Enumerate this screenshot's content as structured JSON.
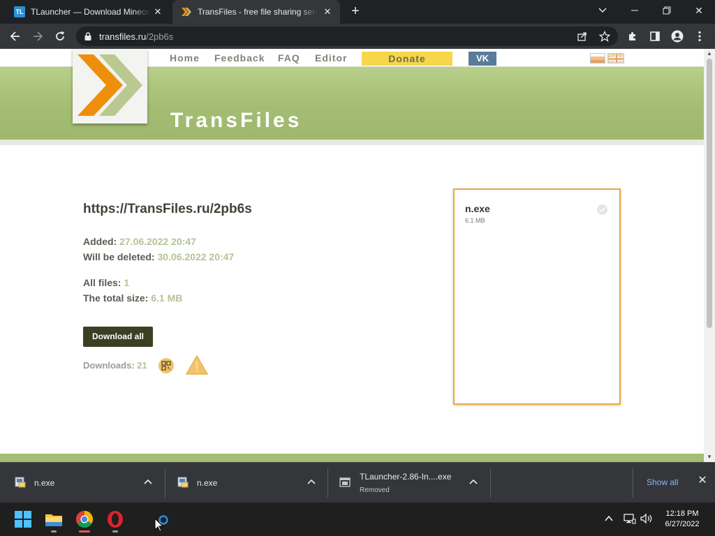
{
  "browser": {
    "tabs": [
      {
        "title": "TLauncher — Download Minecraft",
        "favicon_text": "TL"
      },
      {
        "title": "TransFiles - free file sharing service"
      }
    ],
    "url_host": "transfiles.ru",
    "url_path": "/2pb6s"
  },
  "site": {
    "nav": {
      "home": "Home",
      "feedback": "Feedback",
      "faq": "FAQ",
      "editor": "Editor",
      "donate": "Donate",
      "vk": "VK"
    },
    "title": "TransFiles"
  },
  "page": {
    "file_url": "https://TransFiles.ru/2pb6s",
    "added_label": "Added:",
    "added_value": "27.06.2022 20:47",
    "deleted_label": "Will be deleted:",
    "deleted_value": "30.06.2022 20:47",
    "all_files_label": "All files:",
    "all_files_value": "1",
    "total_size_label": "The total size:",
    "total_size_value": "6.1 MB",
    "download_all": "Download all",
    "downloads_label": "Downloads:",
    "downloads_value": "21"
  },
  "file_card": {
    "name": "n.exe",
    "size": "6.1 MB"
  },
  "download_shelf": {
    "items": [
      {
        "name": "n.exe"
      },
      {
        "name": "n.exe"
      },
      {
        "name": "TLauncher-2.86-In....exe",
        "status": "Removed"
      }
    ],
    "show_all": "Show all"
  },
  "taskbar": {
    "time": "12:18 PM",
    "date": "6/27/2022"
  },
  "colors": {
    "accent_green": "#a4bd73",
    "donate_yellow": "#f6d64a",
    "card_border": "#e8a93c",
    "button_dark": "#3b3f23"
  }
}
